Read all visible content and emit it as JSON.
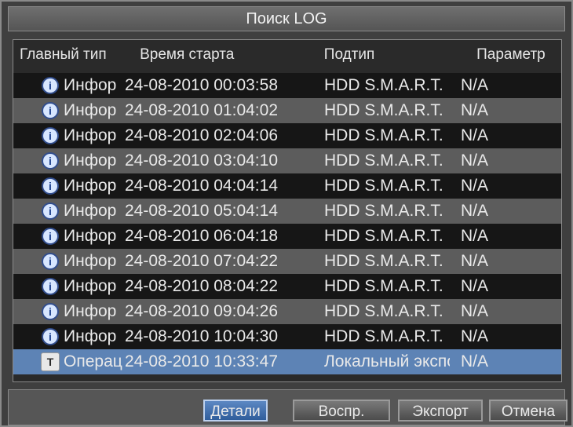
{
  "window": {
    "title": "Поиск LOG"
  },
  "table": {
    "headers": [
      "Главный тип",
      "Время старта",
      "Подтип",
      "Параметр"
    ],
    "rows": [
      {
        "icon": "info-icon",
        "type": "Инфор",
        "time": "24-08-2010 00:03:58",
        "subtype": "HDD S.M.A.R.T.",
        "param": "N/A"
      },
      {
        "icon": "info-icon",
        "type": "Инфор",
        "time": "24-08-2010 01:04:02",
        "subtype": "HDD S.M.A.R.T.",
        "param": "N/A"
      },
      {
        "icon": "info-icon",
        "type": "Инфор",
        "time": "24-08-2010 02:04:06",
        "subtype": "HDD S.M.A.R.T.",
        "param": "N/A"
      },
      {
        "icon": "info-icon",
        "type": "Инфор",
        "time": "24-08-2010 03:04:10",
        "subtype": "HDD S.M.A.R.T.",
        "param": "N/A"
      },
      {
        "icon": "info-icon",
        "type": "Инфор",
        "time": "24-08-2010 04:04:14",
        "subtype": "HDD S.M.A.R.T.",
        "param": "N/A"
      },
      {
        "icon": "info-icon",
        "type": "Инфор",
        "time": "24-08-2010 05:04:14",
        "subtype": "HDD S.M.A.R.T.",
        "param": "N/A"
      },
      {
        "icon": "info-icon",
        "type": "Инфор",
        "time": "24-08-2010 06:04:18",
        "subtype": "HDD S.M.A.R.T.",
        "param": "N/A"
      },
      {
        "icon": "info-icon",
        "type": "Инфор",
        "time": "24-08-2010 07:04:22",
        "subtype": "HDD S.M.A.R.T.",
        "param": "N/A"
      },
      {
        "icon": "info-icon",
        "type": "Инфор",
        "time": "24-08-2010 08:04:22",
        "subtype": "HDD S.M.A.R.T.",
        "param": "N/A"
      },
      {
        "icon": "info-icon",
        "type": "Инфор",
        "time": "24-08-2010 09:04:26",
        "subtype": "HDD S.M.A.R.T.",
        "param": "N/A"
      },
      {
        "icon": "info-icon",
        "type": "Инфор",
        "time": "24-08-2010 10:04:30",
        "subtype": "HDD S.M.A.R.T.",
        "param": "N/A"
      },
      {
        "icon": "operation-icon",
        "type": "Операц",
        "time": "24-08-2010 10:33:47",
        "subtype": "Локальный экспорт",
        "param": "N/A",
        "selected": true
      }
    ]
  },
  "buttons": {
    "details": "Детали",
    "play": "Воспр.",
    "export": "Экспорт",
    "cancel": "Отмена"
  },
  "colors": {
    "selected_row": "#5d83b5",
    "active_button": "#2f5d9b"
  }
}
